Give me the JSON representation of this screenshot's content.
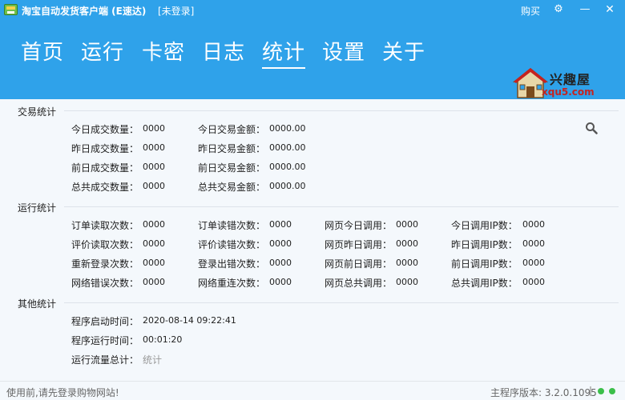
{
  "titlebar": {
    "title": "淘宝自动发货客户端 (E速达)",
    "login_state": "[未登录]",
    "buy_label": "购买",
    "gear_glyph": "⚙",
    "min_glyph": "—",
    "close_glyph": "✕"
  },
  "nav": {
    "items": [
      {
        "label": "首页"
      },
      {
        "label": "运行"
      },
      {
        "label": "卡密"
      },
      {
        "label": "日志"
      },
      {
        "label": "统计"
      },
      {
        "label": "设置"
      },
      {
        "label": "关于"
      }
    ],
    "active": "统计"
  },
  "logo": {
    "text": "兴趣屋",
    "url": "xqu5.com"
  },
  "trade_stats": {
    "title": "交易统计",
    "rows": [
      {
        "count_label": "今日成交数量：",
        "count": "0000",
        "amount_label": "今日交易金额：",
        "amount": "0000.00"
      },
      {
        "count_label": "昨日成交数量：",
        "count": "0000",
        "amount_label": "昨日交易金额：",
        "amount": "0000.00"
      },
      {
        "count_label": "前日成交数量：",
        "count": "0000",
        "amount_label": "前日交易金额：",
        "amount": "0000.00"
      },
      {
        "count_label": "总共成交数量：",
        "count": "0000",
        "amount_label": "总共交易金额：",
        "amount": "0000.00"
      }
    ]
  },
  "run_stats": {
    "title": "运行统计",
    "rows": [
      [
        {
          "label": "订单读取次数：",
          "value": "0000"
        },
        {
          "label": "订单读错次数：",
          "value": "0000"
        },
        {
          "label": "网页今日调用：",
          "value": "0000"
        },
        {
          "label": "今日调用IP数：",
          "value": "0000"
        }
      ],
      [
        {
          "label": "评价读取次数：",
          "value": "0000"
        },
        {
          "label": "评价读错次数：",
          "value": "0000"
        },
        {
          "label": "网页昨日调用：",
          "value": "0000"
        },
        {
          "label": "昨日调用IP数：",
          "value": "0000"
        }
      ],
      [
        {
          "label": "重新登录次数：",
          "value": "0000"
        },
        {
          "label": "登录出错次数：",
          "value": "0000"
        },
        {
          "label": "网页前日调用：",
          "value": "0000"
        },
        {
          "label": "前日调用IP数：",
          "value": "0000"
        }
      ],
      [
        {
          "label": "网络错误次数：",
          "value": "0000"
        },
        {
          "label": "网络重连次数：",
          "value": "0000"
        },
        {
          "label": "网页总共调用：",
          "value": "0000"
        },
        {
          "label": "总共调用IP数：",
          "value": "0000"
        }
      ]
    ]
  },
  "other_stats": {
    "title": "其他统计",
    "start_time_label": "程序启动时间：",
    "start_time": "2020-08-14 09:22:41",
    "run_time_label": "程序运行时间：",
    "run_time": "00:01:20",
    "traffic_label": "运行流量总计：",
    "traffic_link": "统计"
  },
  "statusbar": {
    "message": "使用前,请先登录购物网站!",
    "version": "主程序版本: 3.2.0.1095",
    "status_colors": [
      "#3cbf4a",
      "#3cbf4a"
    ]
  },
  "colors": {
    "header_bg": "#2fa2ea",
    "content_bg": "#f4f8fc"
  }
}
